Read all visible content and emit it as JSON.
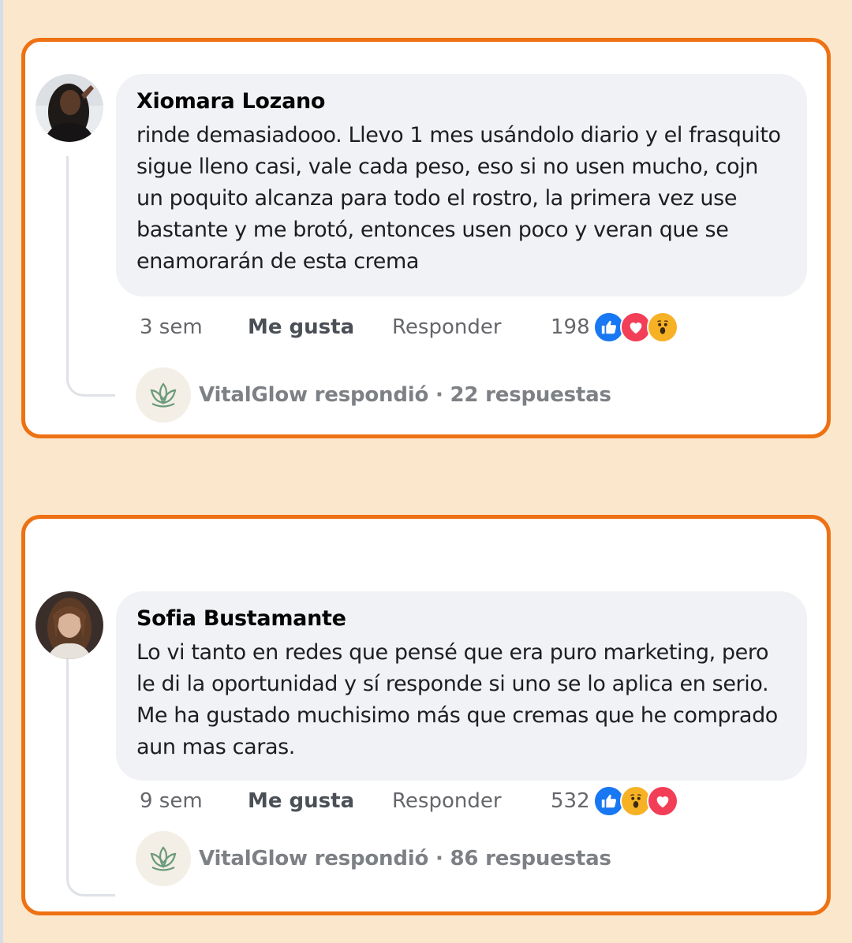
{
  "comments": [
    {
      "author": "Xiomara Lozano",
      "text": "rinde demasiadooo. Llevo 1 mes usándolo diario y el frasquito sigue lleno casi, vale cada peso, eso si no usen mucho, cojn un poquito alcanza para todo el rostro, la primera vez use bastante y me brotó, entonces usen poco y veran que se enamorarán de esta crema",
      "time": "3 sem",
      "like_label": "Me gusta",
      "reply_label": "Responder",
      "reaction_count": "198",
      "reactions": [
        "like-icon",
        "love-icon",
        "wow-icon"
      ],
      "replies_summary": "VitalGlow respondió · 22 respuestas"
    },
    {
      "author": "Sofia Bustamante",
      "text": "Lo vi tanto en redes que pensé que era puro marketing, pero le di la oportunidad y sí responde si uno se lo aplica en serio. Me ha gustado muchisimo más que cremas que he comprado aun mas caras.",
      "time": "9 sem",
      "like_label": "Me gusta",
      "reply_label": "Responder",
      "reaction_count": "532",
      "reactions": [
        "like-icon",
        "wow-icon",
        "love-icon"
      ],
      "replies_summary": "VitalGlow respondió · 86 respuestas"
    }
  ],
  "colors": {
    "page_background": "#fbe8cc",
    "card_border": "#ee7113",
    "bubble": "#f0f2f5",
    "like": "#1877f2",
    "love": "#f33e58",
    "wow": "#f7b125"
  }
}
